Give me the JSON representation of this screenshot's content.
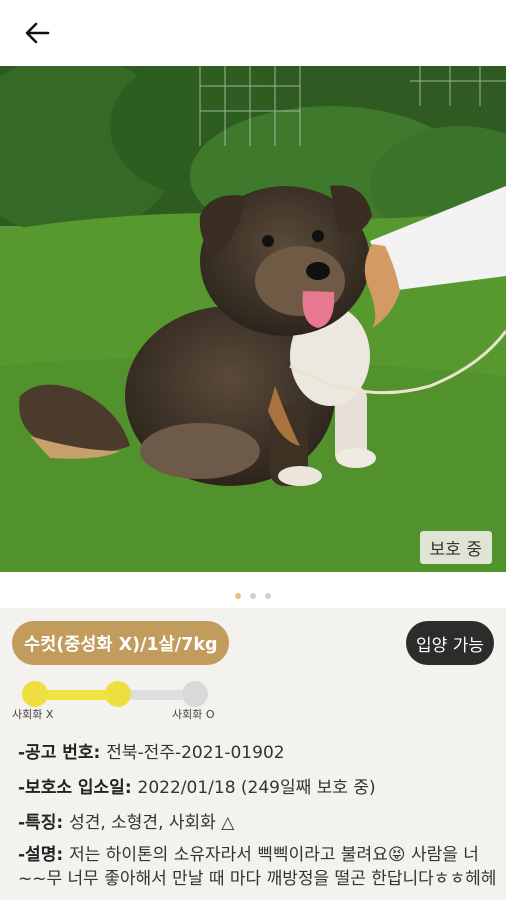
{
  "header": {
    "back_icon": "arrow-left-icon"
  },
  "photo": {
    "status_badge": "보호 중",
    "carousel": {
      "current": 1,
      "total": 3
    }
  },
  "pet": {
    "summary": "수컷(중성화 X)/1살/7kg",
    "adopt_label": "입양 가능",
    "socialization": {
      "left_label": "사회화 X",
      "right_label": "사회화 O",
      "level": 0.5
    }
  },
  "details": {
    "notice_key": "-공고 번호: ",
    "notice_value": "전북-전주-2021-01902",
    "admission_key": "-보호소 입소일: ",
    "admission_value": "2022/01/18 (249일째 보호 중)",
    "traits_key": "-특징: ",
    "traits_value": "성견, 소형견, 사회화 △",
    "description_key": "-설명: ",
    "description_value": "저는 하이톤의 소유자라서 삑삑이라고 불려요😝 사람을 너~~무 너무 좋아해서 만날 때 마다 깨방정을 떨곤 한답니다ㅎㅎ헤헤"
  },
  "colors": {
    "accent": "#c19c5d",
    "adopt_chip": "#2e2c2a",
    "social_on": "#f1e244",
    "dot_active": "#e7c07e"
  }
}
